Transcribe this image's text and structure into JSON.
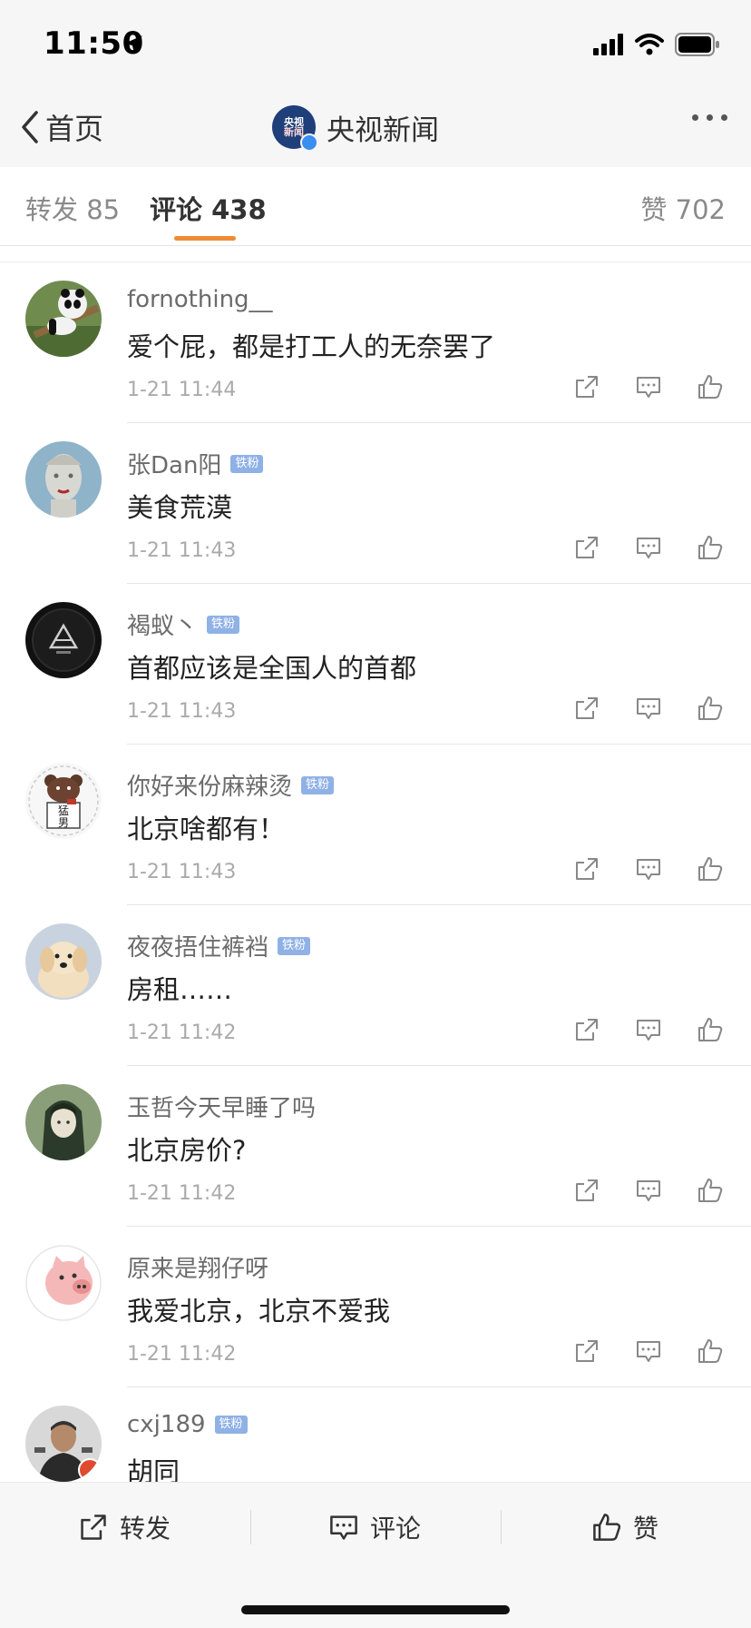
{
  "status_bar": {
    "time": "11:50"
  },
  "nav": {
    "back_label": "首页",
    "title": "央视新闻",
    "avatar_line1": "央视",
    "avatar_line2": "新闻"
  },
  "tabs": {
    "repost_label": "转发",
    "repost_count": "85",
    "comments_label": "评论",
    "comments_count": "438",
    "likes_label": "赞",
    "likes_count": "702"
  },
  "comments": [
    {
      "username": "fornothing__",
      "fan_badge": "",
      "text": "爱个屁，都是打工人的无奈罢了",
      "time": "1-21 11:44",
      "avatar": "panda"
    },
    {
      "username": "张Dan阳",
      "fan_badge": "铁粉",
      "text": "美食荒漠",
      "time": "1-21 11:43",
      "avatar": "statue"
    },
    {
      "username": "褐蚁丶",
      "fan_badge": "铁粉",
      "text": "首都应该是全国人的首都",
      "time": "1-21 11:43",
      "avatar": "dark-logo"
    },
    {
      "username": "你好来份麻辣烫",
      "fan_badge": "铁粉",
      "text": "北京啥都有！",
      "time": "1-21 11:43",
      "avatar": "bear"
    },
    {
      "username": "夜夜捂住裤裆",
      "fan_badge": "铁粉",
      "text": "房租……",
      "time": "1-21 11:42",
      "avatar": "puppy"
    },
    {
      "username": "玉哲今天早睡了吗",
      "fan_badge": "",
      "text": "北京房价?",
      "time": "1-21 11:42",
      "avatar": "anime-girl"
    },
    {
      "username": "原来是翔仔呀",
      "fan_badge": "",
      "text": "我爱北京，北京不爱我",
      "time": "1-21 11:42",
      "avatar": "pig"
    },
    {
      "username": "cxj189",
      "fan_badge": "铁粉",
      "text": "胡同",
      "time": "",
      "avatar": "man-photo"
    }
  ],
  "avatar_texts": {
    "bear_text_1": "猛",
    "bear_text_2": "男"
  },
  "bottom_bar": {
    "repost_label": "转发",
    "comment_label": "评论",
    "like_label": "赞"
  },
  "colors": {
    "accent": "#ee8a33",
    "fan_badge": "#8fb1e6",
    "verified": "#3b8df0"
  }
}
